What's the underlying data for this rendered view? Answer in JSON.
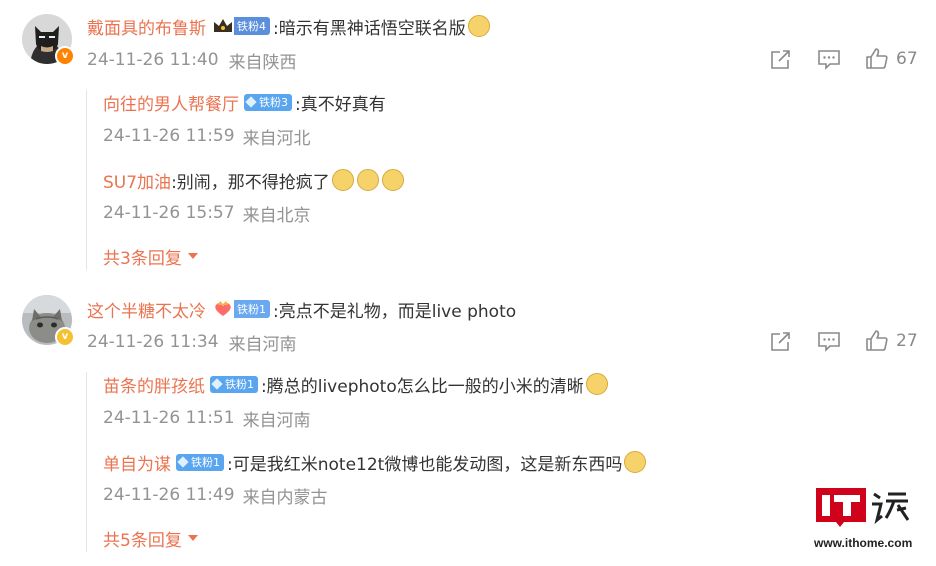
{
  "comments": [
    {
      "user": "戴面具的布鲁斯",
      "badge": "铁粉4",
      "text": ":暗示有黑神话悟空联名版",
      "time": "24-11-26 11:40",
      "location": "来自陕西",
      "likes": "67",
      "replies": [
        {
          "user": "向往的男人帮餐厅",
          "badge": "铁粉3",
          "text": ":真不好真有",
          "time": "24-11-26 11:59",
          "location": "来自河北"
        },
        {
          "user": "SU7加油",
          "badge": "",
          "text": ":别闹，那不得抢疯了",
          "time": "24-11-26 15:57",
          "location": "来自北京"
        }
      ],
      "more": "共3条回复"
    },
    {
      "user": "这个半糖不太冷",
      "badge": "铁粉1",
      "text": ":亮点不是礼物，而是live photo",
      "time": "24-11-26 11:34",
      "location": "来自河南",
      "likes": "27",
      "replies": [
        {
          "user": "苗条的胖孩纸",
          "badge": "铁粉1",
          "text": ":腾总的livephoto怎么比一般的小米的清晰",
          "time": "24-11-26 11:51",
          "location": "来自河南"
        },
        {
          "user": "单自为谋",
          "badge": "铁粉1",
          "text": ":可是我红米note12t微博也能发动图，这是新东西吗",
          "time": "24-11-26 11:49",
          "location": "来自内蒙古"
        }
      ],
      "more": "共5条回复"
    }
  ],
  "watermark": {
    "url": "www.ithome.com"
  },
  "colors": {
    "name": "#eb7350",
    "meta": "#939393",
    "badge": "#5aa5f0",
    "verified": "#ff8200"
  }
}
